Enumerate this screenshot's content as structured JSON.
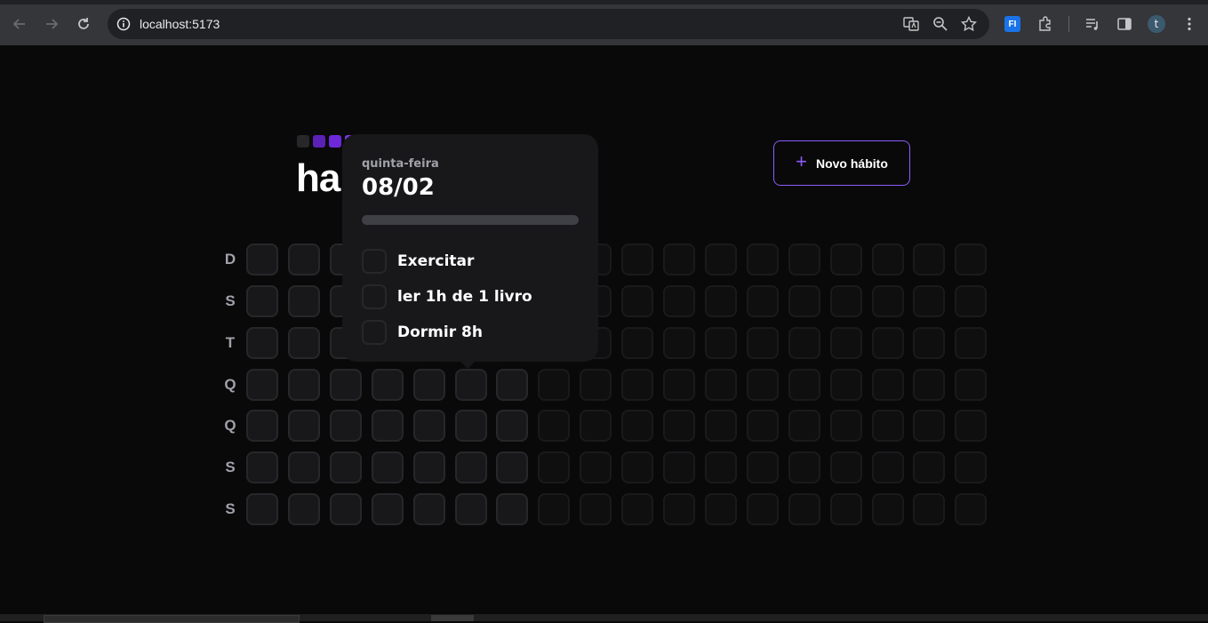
{
  "browser": {
    "url": "localhost:5173",
    "icons": [
      "back-icon",
      "forward-icon",
      "reload-icon",
      "info-icon",
      "translate-icon",
      "zoom-icon",
      "star-icon",
      "extension-fi-icon",
      "puzzle-icon",
      "media-icon",
      "sidepanel-icon",
      "profile-icon",
      "menu-icon"
    ],
    "profile_initial": "t",
    "ext_label": "FI"
  },
  "app": {
    "title": "ha",
    "logo_colors": [
      "#27272a",
      "#5b21b6",
      "#6d28d9",
      "#7c3aed"
    ],
    "new_habit_label": "Novo hábito",
    "plus_symbol": "+",
    "accent": "#8b5cf6"
  },
  "week_days": [
    "D",
    "S",
    "T",
    "Q",
    "Q",
    "S",
    "S"
  ],
  "popover": {
    "weekday": "quinta-feira",
    "date": "08/02",
    "progress": 0,
    "habits": [
      {
        "label": "Exercitar",
        "checked": false
      },
      {
        "label": "ler 1h de 1 livro",
        "checked": false
      },
      {
        "label": "Dormir 8h",
        "checked": false
      }
    ]
  }
}
